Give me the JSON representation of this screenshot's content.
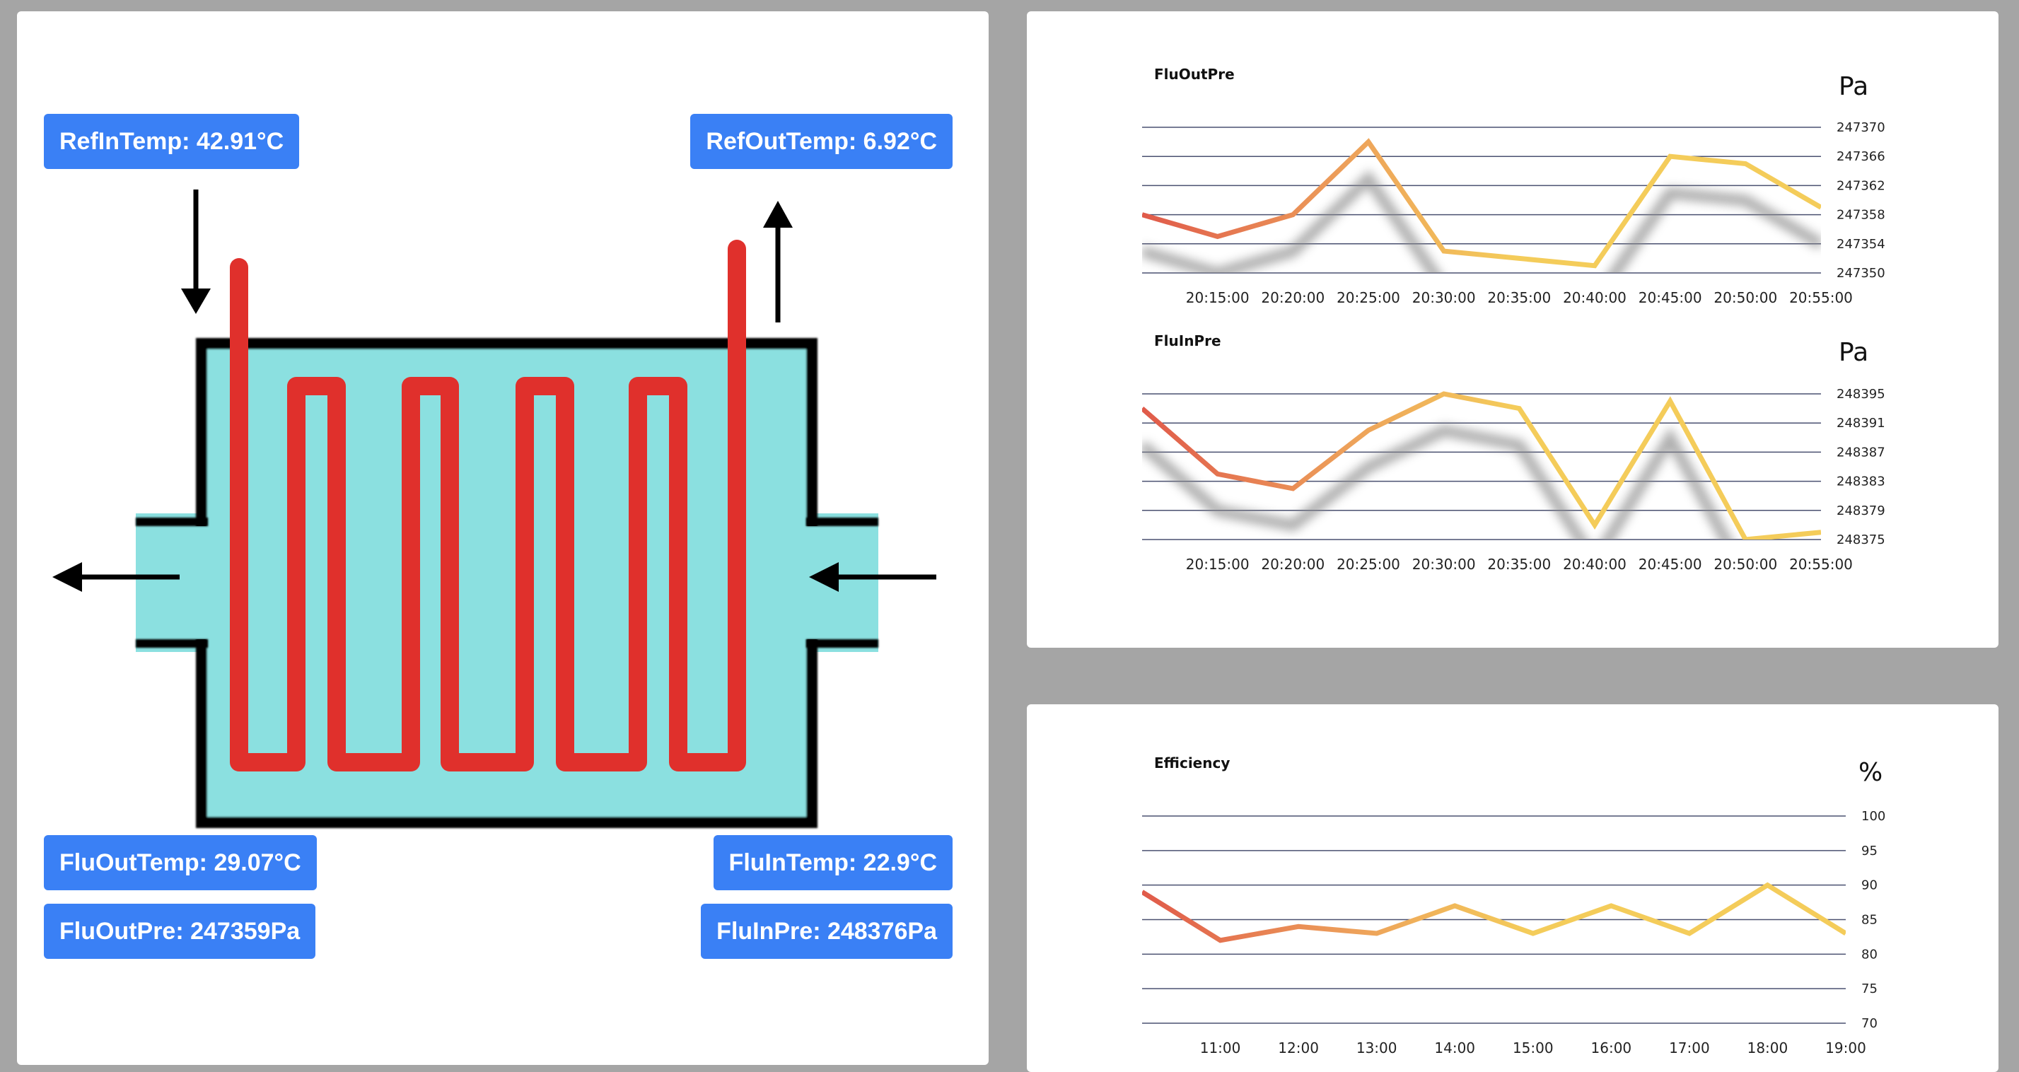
{
  "labels": {
    "ref_in_temp": "RefInTemp: 42.91°C",
    "ref_out_temp": "RefOutTemp: 6.92°C",
    "flu_out_temp": "FluOutTemp: 29.07°C",
    "flu_in_temp": "FluInTemp: 22.9°C",
    "flu_out_pre": "FluOutPre: 247359Pa",
    "flu_in_pre": "FluInPre: 248376Pa"
  },
  "colors": {
    "tag_bg": "#3a80f5",
    "pipe": "#e0302c",
    "fluid": "#8be0e0",
    "line_start": "#e05a4a",
    "line_mid": "#eda05a",
    "line_end": "#f4cc5a"
  },
  "icons": {
    "arrows": [
      "arrow-down-icon",
      "arrow-up-icon",
      "arrow-left-icon",
      "arrow-left-icon"
    ]
  },
  "chart_data": [
    {
      "type": "line",
      "title": "FluOutPre",
      "unit": "Pa",
      "x": [
        "20:15:00",
        "20:20:00",
        "20:25:00",
        "20:30:00",
        "20:35:00",
        "20:40:00",
        "20:45:00",
        "20:50:00",
        "20:55:00"
      ],
      "y_ticks": [
        247370,
        247366,
        247362,
        247358,
        247354,
        247350
      ],
      "ylim": [
        247350,
        247370
      ],
      "series": [
        {
          "points": [
            [
              -1,
              247358
            ],
            [
              0,
              247355
            ],
            [
              1,
              247358
            ],
            [
              2,
              247368
            ],
            [
              3,
              247353
            ],
            [
              4,
              247352
            ],
            [
              5,
              247351
            ],
            [
              6,
              247366
            ],
            [
              7,
              247365
            ],
            [
              8,
              247359
            ]
          ]
        }
      ]
    },
    {
      "type": "line",
      "title": "FluInPre",
      "unit": "Pa",
      "x": [
        "20:15:00",
        "20:20:00",
        "20:25:00",
        "20:30:00",
        "20:35:00",
        "20:40:00",
        "20:45:00",
        "20:50:00",
        "20:55:00"
      ],
      "y_ticks": [
        248395,
        248391,
        248387,
        248383,
        248379,
        248375
      ],
      "ylim": [
        248375,
        248395
      ],
      "series": [
        {
          "points": [
            [
              -1,
              248393
            ],
            [
              0,
              248384
            ],
            [
              1,
              248382
            ],
            [
              2,
              248390
            ],
            [
              3,
              248395
            ],
            [
              4,
              248393
            ],
            [
              5,
              248377
            ],
            [
              6,
              248394
            ],
            [
              7,
              248375
            ],
            [
              8,
              248376
            ]
          ]
        }
      ]
    },
    {
      "type": "line",
      "title": "Efficiency",
      "unit": "%",
      "x": [
        "11:00",
        "12:00",
        "13:00",
        "14:00",
        "15:00",
        "16:00",
        "17:00",
        "18:00",
        "19:00"
      ],
      "y_ticks": [
        100,
        95,
        90,
        85,
        80,
        75,
        70
      ],
      "ylim": [
        70,
        100
      ],
      "series": [
        {
          "points": [
            [
              -1,
              89
            ],
            [
              0,
              82
            ],
            [
              1,
              84
            ],
            [
              2,
              83
            ],
            [
              3,
              87
            ],
            [
              4,
              83
            ],
            [
              5,
              87
            ],
            [
              6,
              83
            ],
            [
              7,
              90
            ],
            [
              8,
              83
            ]
          ]
        }
      ]
    }
  ]
}
